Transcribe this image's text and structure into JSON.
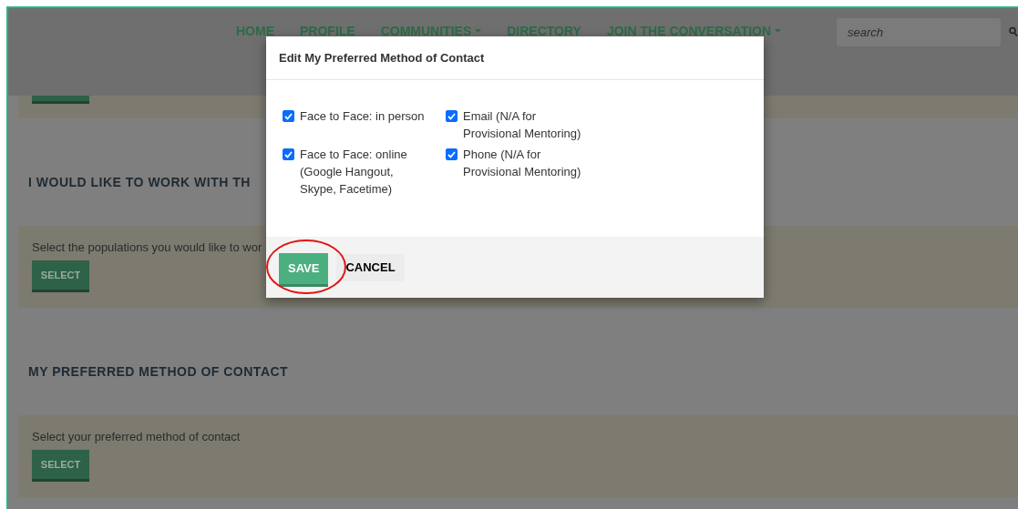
{
  "nav": {
    "items": [
      {
        "label": "HOME",
        "dropdown": false
      },
      {
        "label": "PROFILE",
        "dropdown": false
      },
      {
        "label": "COMMUNITIES",
        "dropdown": true
      },
      {
        "label": "DIRECTORY",
        "dropdown": false
      },
      {
        "label": "JOIN THE CONVERSATION",
        "dropdown": true
      }
    ],
    "search": {
      "placeholder": "search"
    }
  },
  "sections": [
    {
      "heading": "I WOULD LIKE TO WORK WITH TH",
      "prompt": "Select the populations you would like to wor",
      "button": "SELECT"
    },
    {
      "heading": "MY PREFERRED METHOD OF CONTACT",
      "prompt": "Select your preferred method of contact",
      "button": "SELECT"
    }
  ],
  "modal": {
    "title": "Edit My Preferred Method of Contact",
    "options": [
      {
        "label": "Face to Face: in person",
        "checked": true
      },
      {
        "label": "Email (N/A for Provisional Mentoring)",
        "checked": true
      },
      {
        "label": "Face to Face: online (Google Hangout, Skype, Facetime)",
        "checked": true
      },
      {
        "label": "Phone (N/A for Provisional Mentoring)",
        "checked": true
      }
    ],
    "buttons": [
      {
        "label": "SAVE",
        "kind": "primary"
      },
      {
        "label": "CANCEL",
        "kind": "secondary"
      }
    ]
  }
}
